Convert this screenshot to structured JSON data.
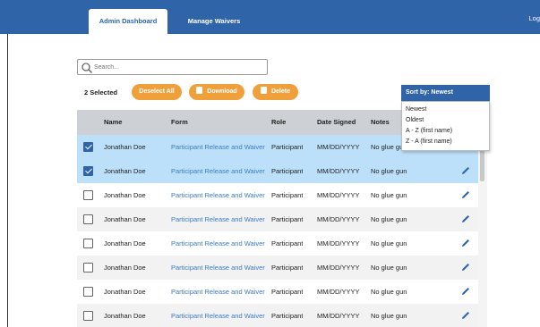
{
  "header": {
    "tabs": [
      {
        "label": "Admin Dashboard",
        "active": true
      },
      {
        "label": "Manage Waivers",
        "active": false
      }
    ],
    "logout_label": "Log"
  },
  "search": {
    "placeholder": "Search..."
  },
  "toolbar": {
    "selected_count": "2 Selected",
    "deselect_label": "Deselect All",
    "download_label": "Download",
    "delete_label": "Delete"
  },
  "sort": {
    "button_label": "Sort by: Newest",
    "options": [
      "Newest",
      "Oldest",
      "A - Z (first name)",
      "Z - A (first name)"
    ]
  },
  "table": {
    "columns": [
      "Name",
      "Form",
      "Role",
      "Date Signed",
      "Notes"
    ],
    "rows": [
      {
        "selected": true,
        "name": "Jonathan Doe",
        "form": "Participant Release and Waiver",
        "role": "Participant",
        "date": "MM/DD/YYYY",
        "notes": "No glue gun"
      },
      {
        "selected": true,
        "name": "Jonathan Doe",
        "form": "Participant Release and Waiver",
        "role": "Participant",
        "date": "MM/DD/YYYY",
        "notes": "No glue gun"
      },
      {
        "selected": false,
        "name": "Jonathan Doe",
        "form": "Participant Release and Waiver",
        "role": "Participant",
        "date": "MM/DD/YYYY",
        "notes": "No glue gun"
      },
      {
        "selected": false,
        "name": "Jonathan Doe",
        "form": "Participant Release and Waiver",
        "role": "Participant",
        "date": "MM/DD/YYYY",
        "notes": "No glue gun"
      },
      {
        "selected": false,
        "name": "Jonathan Doe",
        "form": "Participant Release and Waiver",
        "role": "Participant",
        "date": "MM/DD/YYYY",
        "notes": "No glue gun"
      },
      {
        "selected": false,
        "name": "Jonathan Doe",
        "form": "Participant Release and Waiver",
        "role": "Participant",
        "date": "MM/DD/YYYY",
        "notes": "No glue gun"
      },
      {
        "selected": false,
        "name": "Jonathan Doe",
        "form": "Participant Release and Waiver",
        "role": "Participant",
        "date": "MM/DD/YYYY",
        "notes": "No glue gun"
      },
      {
        "selected": false,
        "name": "Jonathan Doe",
        "form": "Participant Release and Waiver",
        "role": "Participant",
        "date": "MM/DD/YYYY",
        "notes": "No glue gun"
      }
    ]
  },
  "icons": {
    "search": "search-icon",
    "edit": "pencil-icon",
    "download": "file-icon",
    "delete": "trash-icon"
  },
  "colors": {
    "primary": "#2f64a8",
    "accent": "#f0a03a",
    "selected_row": "#bde0fa",
    "link": "#3a7bc8"
  }
}
